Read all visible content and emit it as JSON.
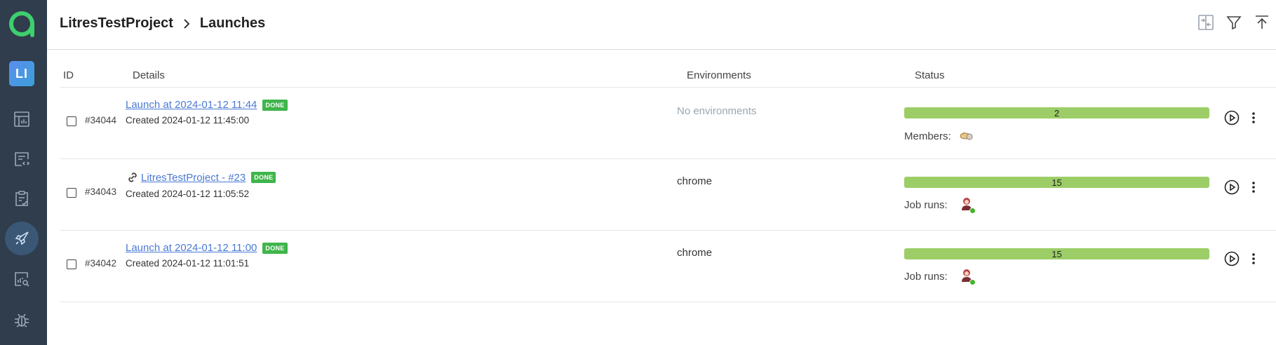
{
  "sidebar": {
    "project_badge": "LI",
    "nav": [
      {
        "icon": "dashboard-icon",
        "name": "nav-dashboards"
      },
      {
        "icon": "test-cases-icon",
        "name": "nav-test-cases"
      },
      {
        "icon": "test-plans-icon",
        "name": "nav-test-plans"
      },
      {
        "icon": "launches-icon",
        "name": "nav-launches",
        "active": true
      },
      {
        "icon": "analytics-icon",
        "name": "nav-analytics"
      },
      {
        "icon": "defects-icon",
        "name": "nav-defects"
      }
    ]
  },
  "header": {
    "project": "LitresTestProject",
    "page": "Launches",
    "actions": [
      "compare-icon",
      "filter-icon",
      "upload-icon"
    ]
  },
  "table": {
    "headers": {
      "id": "ID",
      "details": "Details",
      "environments": "Environments",
      "status": "Status"
    },
    "rows": [
      {
        "id": "#34044",
        "title": "Launch at 2024-01-12 11:44",
        "badge": "DONE",
        "created": "Created 2024-01-12 11:45:00",
        "environment": "No environments",
        "status_count": "2",
        "meta_label": "Members:",
        "has_link_icon": false
      },
      {
        "id": "#34043",
        "title": "LitresTestProject - #23",
        "badge": "DONE",
        "created": "Created 2024-01-12 11:05:52",
        "environment": "chrome",
        "status_count": "15",
        "meta_label": "Job runs:",
        "has_link_icon": true
      },
      {
        "id": "#34042",
        "title": "Launch at 2024-01-12 11:00",
        "badge": "DONE",
        "created": "Created 2024-01-12 11:01:51",
        "environment": "chrome",
        "status_count": "15",
        "meta_label": "Job runs:",
        "has_link_icon": false
      }
    ]
  },
  "colors": {
    "sidebar_bg": "#2f3d4c",
    "done_badge": "#3fb54b",
    "status_bar": "#9ccd67",
    "link": "#4a7ad6"
  }
}
